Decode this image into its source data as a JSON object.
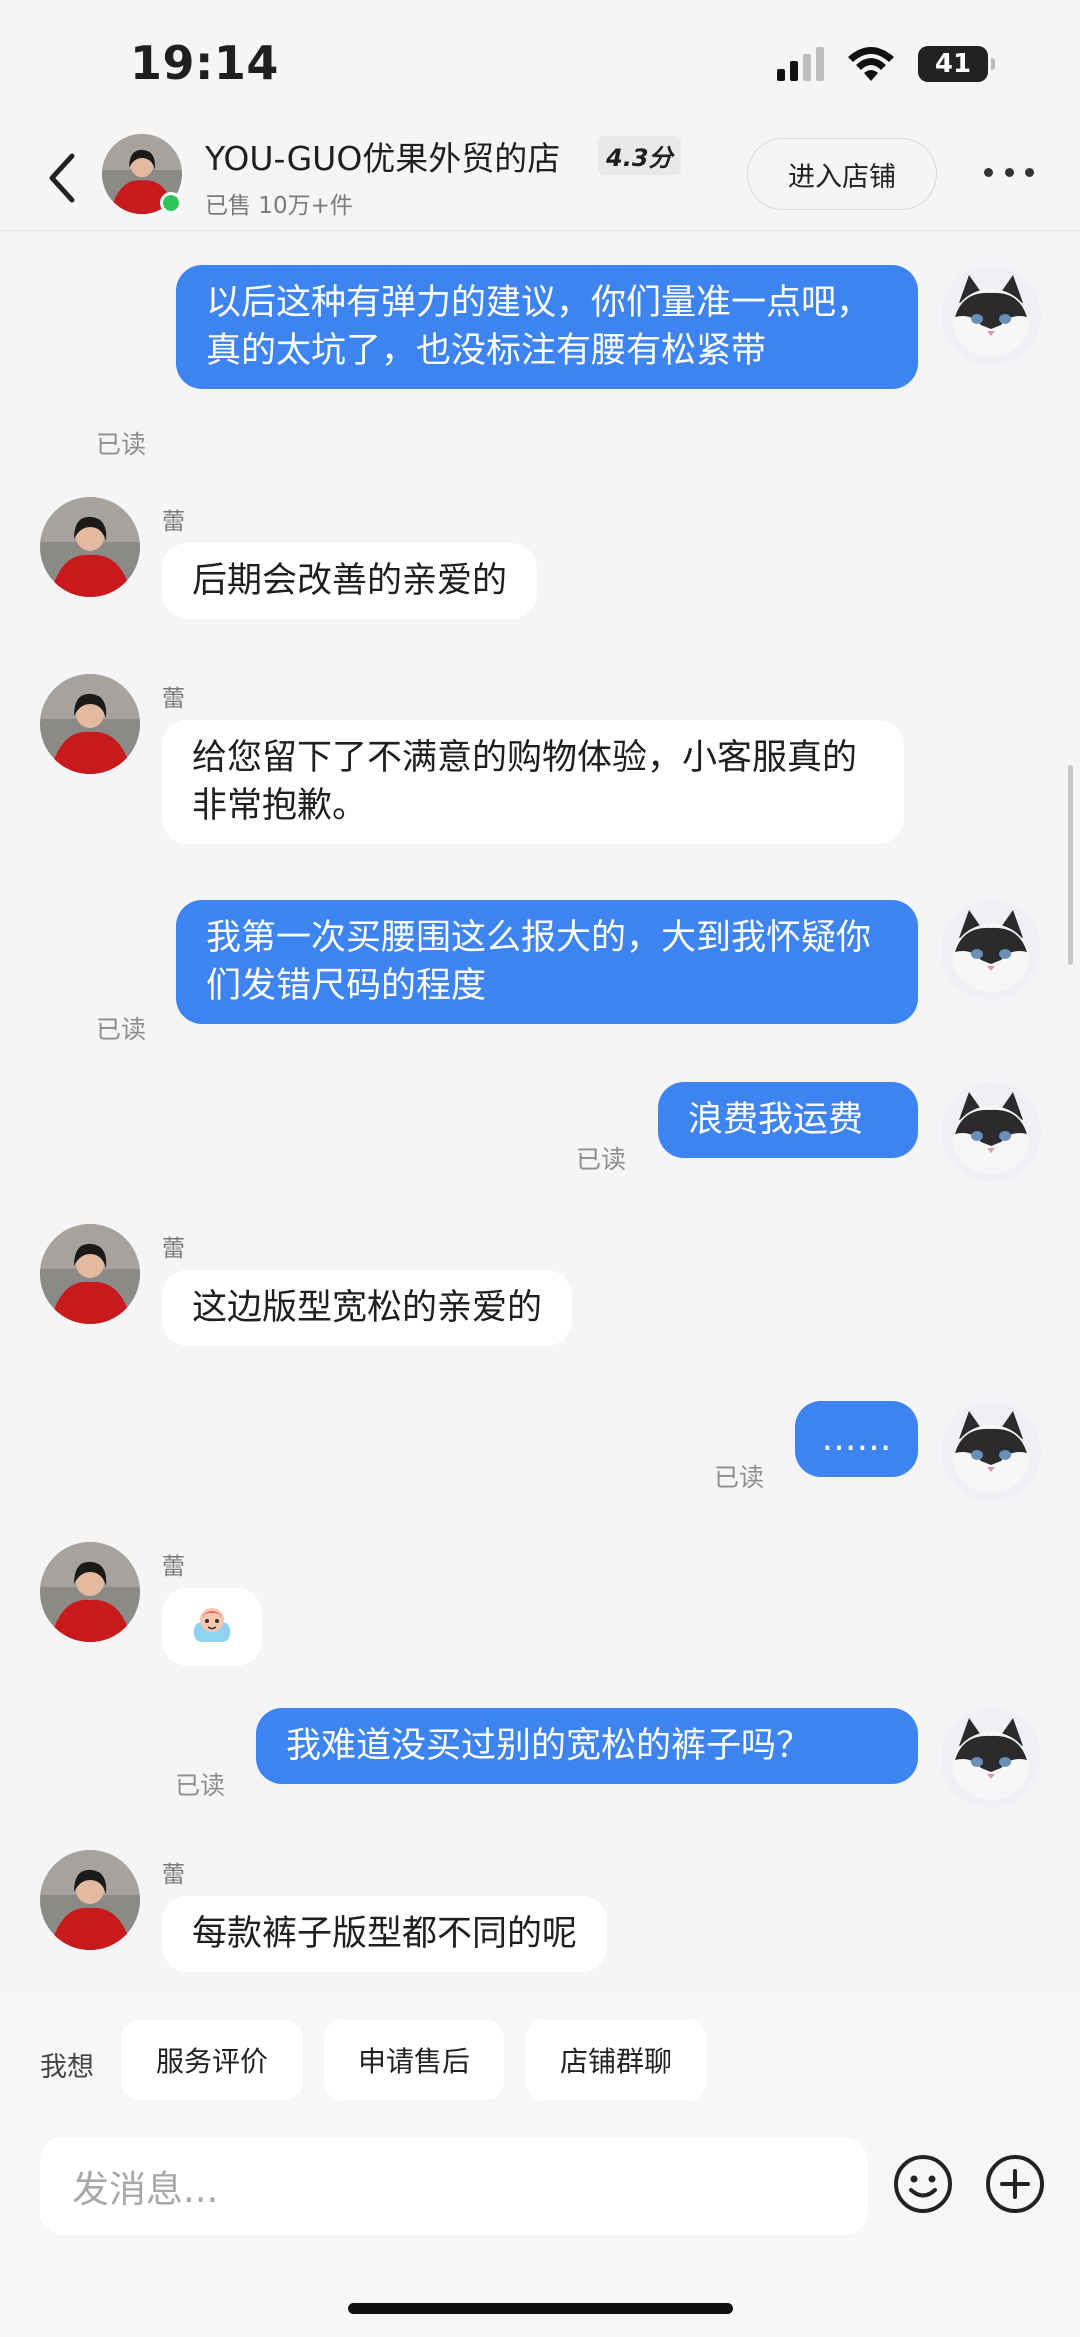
{
  "status": {
    "time": "19:14",
    "battery": "41"
  },
  "header": {
    "shop_name": "YOU-GUO优果外贸的店",
    "rating": "4.3分",
    "sold": "已售 10万+件",
    "enter_shop": "进入店铺"
  },
  "messages": [
    {
      "from": "me",
      "text": "以后这种有弹力的建议，你们量准一点吧，真的太坑了，也没标注有腰有松紧带",
      "status": "已读"
    },
    {
      "from": "shop",
      "sender": "蕾",
      "text": "后期会改善的亲爱的"
    },
    {
      "from": "shop",
      "sender": "蕾",
      "text": "给您留下了不满意的购物体验，小客服真的非常抱歉。"
    },
    {
      "from": "me",
      "text": "我第一次买腰围这么报大的，大到我怀疑你们发错尺码的程度",
      "status": "已读"
    },
    {
      "from": "me",
      "text": "浪费我运费",
      "status": "已读"
    },
    {
      "from": "shop",
      "sender": "蕾",
      "text": "这边版型宽松的亲爱的"
    },
    {
      "from": "me",
      "text": "……",
      "status": "已读"
    },
    {
      "from": "shop",
      "sender": "蕾",
      "sticker": "sticker-icon"
    },
    {
      "from": "me",
      "text": "我难道没买过别的宽松的裤子吗？",
      "status": "已读"
    },
    {
      "from": "shop",
      "sender": "蕾",
      "text": "每款裤子版型都不同的呢"
    }
  ],
  "quick_actions": {
    "label": "我想",
    "items": [
      "服务评价",
      "申请售后",
      "店铺群聊"
    ]
  },
  "input": {
    "placeholder": "发消息..."
  },
  "colors": {
    "outgoing_bubble": "#3d84f1",
    "background": "#f5f5f7",
    "online": "#2fc45a"
  }
}
